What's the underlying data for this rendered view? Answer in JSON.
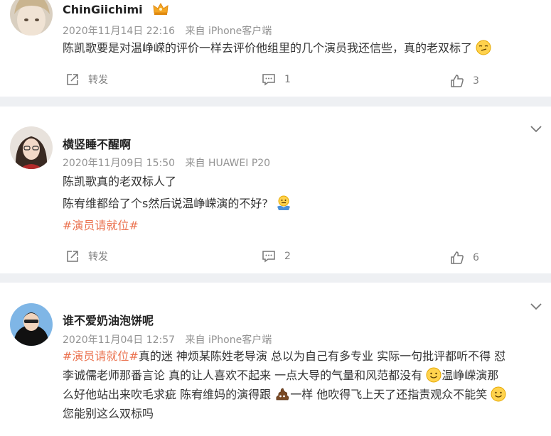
{
  "comments": [
    {
      "username": "ChinGiichimi",
      "time": "2020年11月14日 22:16",
      "source": "来自 iPhone客户端",
      "lines": [
        "陈凯歌要是对温峥嵘的评价一样去评价他组里的几个演员我还信些，真的老双标了"
      ],
      "repost_label": "转发",
      "comment_count": "1",
      "like_count": "3"
    },
    {
      "username": "横竖睡不醒啊",
      "time": "2020年11月09日 15:50",
      "source": "来自 HUAWEI P20",
      "lines": [
        "陈凯歌真的老双标人了",
        "陈宥维都给了个s然后说温峥嵘演的不好?"
      ],
      "hashtag": "#演员请就位#",
      "repost_label": "转发",
      "comment_count": "2",
      "like_count": "6"
    },
    {
      "username": "谁不爱奶油泡饼呢",
      "time": "2020年11月04日 12:57",
      "source": "来自 iPhone客户端",
      "hashtag": "#演员请就位#",
      "lines": [
        "真的迷 神烦某陈姓老导演 总以为自己有多专业 实际一句批评都听不得 怼",
        "李诚儒老师那番言论 真的让人喜欢不起来 一点大导的气量和风范都没有",
        "温峥嵘演那",
        "么好他站出来吹毛求疵 陈宥维妈的演得跟",
        "一样 他吹得飞上天了还指责观众不能笑",
        "您能别这么双标吗"
      ]
    }
  ],
  "icons": {
    "repost": "share-out-icon",
    "comment": "comment-bubble-icon",
    "like": "thumbs-up-icon",
    "expand": "chevron-down-icon",
    "member_badge": "crown-badge-icon"
  },
  "colors": {
    "hashtag": "#eb7350",
    "meta": "#939393",
    "background": "#eef0f3"
  }
}
